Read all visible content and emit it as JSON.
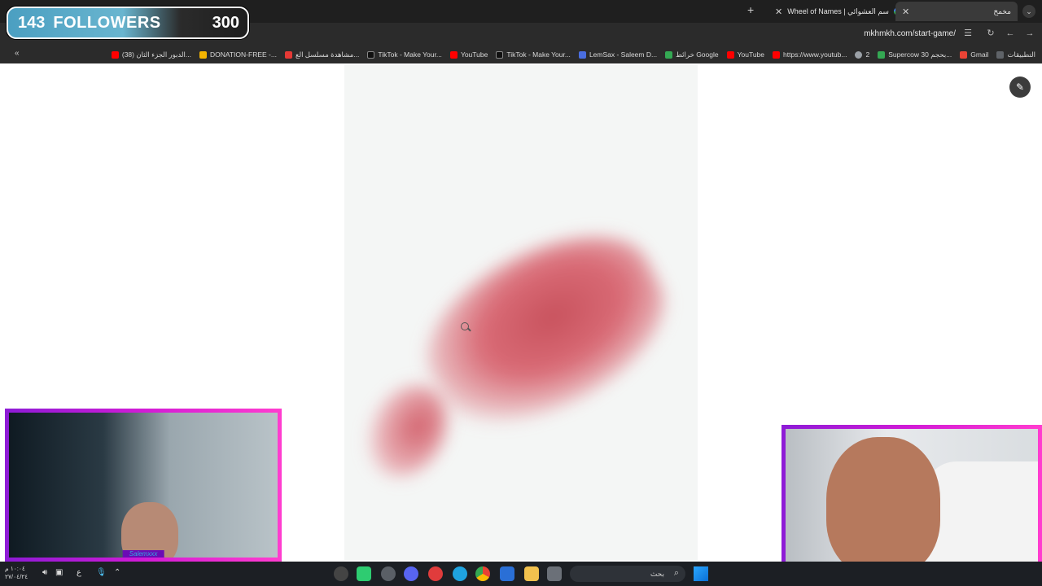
{
  "widget": {
    "followers_count": "143",
    "followers_label": "FOLLOWERS",
    "followers_goal": "300"
  },
  "tabs": [
    {
      "label": "Wheel of Names | سم العشوائي"
    },
    {
      "label": "مخمخ"
    }
  ],
  "address": {
    "url": "mkhmkh.com/start-game/"
  },
  "bookmarks": [
    {
      "label": "التطبيقات",
      "color": "#5f6368"
    },
    {
      "label": "Gmail",
      "color": "#ea4335"
    },
    {
      "label": "Supercow بحجم 30...",
      "color": "#34a853"
    },
    {
      "label": "2",
      "color": "#9aa0a6"
    },
    {
      "label": "https://www.youtub...",
      "color": "#ff0000"
    },
    {
      "label": "YouTube",
      "color": "#ff0000"
    },
    {
      "label": "خرائط Google",
      "color": "#34a853"
    },
    {
      "label": "LemSax - Saleem D...",
      "color": "#4a6ee0"
    },
    {
      "label": "TikTok - Make Your...",
      "color": "#111111"
    },
    {
      "label": "YouTube",
      "color": "#ff0000"
    },
    {
      "label": "TikTok - Make Your...",
      "color": "#111111"
    },
    {
      "label": "مشاهدة مسلسل الع...",
      "color": "#e53935"
    },
    {
      "label": "DONATION-FREE -...",
      "color": "#f4b400"
    },
    {
      "label": "(38) الدبور الجزء الثان...",
      "color": "#ff0000"
    }
  ],
  "taskbar": {
    "search_placeholder": "بحث",
    "clock_time": "١٠:٠٤ م",
    "clock_date": "٢٧/٠٤/٢٤",
    "lang": "ع"
  },
  "webcam": {
    "signature": "Salemxxx"
  },
  "colors": {
    "cam_border": "#d21bd6",
    "widget_blue": "#4b9fc1"
  }
}
